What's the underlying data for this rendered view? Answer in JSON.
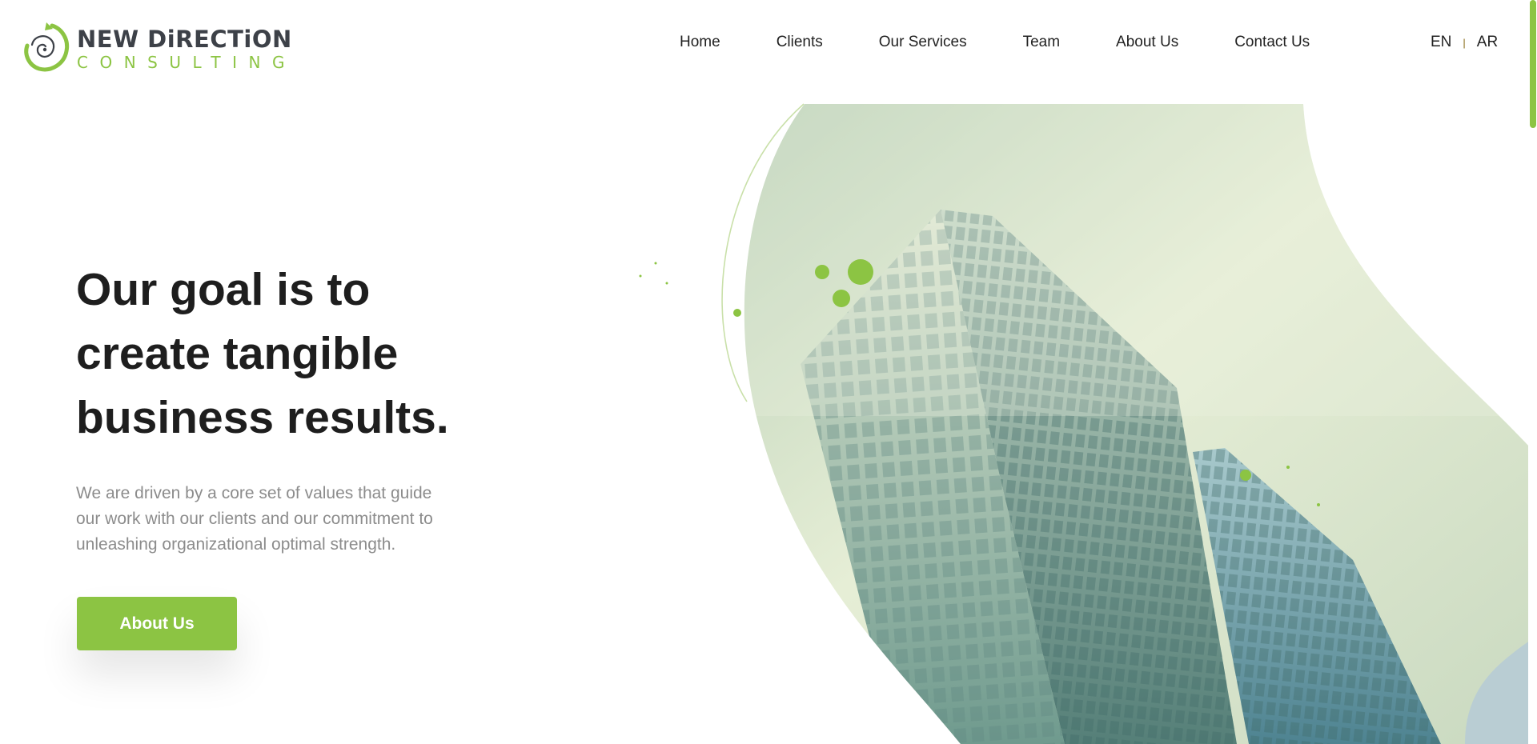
{
  "brand": {
    "name_line1": "NEW DiRECTiON",
    "name_line2": "CONSULTING",
    "logo_icon": "spiral-logo-icon",
    "accent_color": "#8cc443",
    "dark_color": "#3d4148"
  },
  "nav": {
    "items": [
      {
        "label": "Home"
      },
      {
        "label": "Clients"
      },
      {
        "label": "Our Services"
      },
      {
        "label": "Team"
      },
      {
        "label": "About Us"
      },
      {
        "label": "Contact Us"
      }
    ]
  },
  "language": {
    "en": "EN",
    "separator": "|",
    "ar": "AR"
  },
  "hero": {
    "title": "Our goal is to create tangible business results.",
    "description": "We are driven by a core set of values that guide our work with our clients and our commitment to unleashing organizational optimal strength.",
    "cta_label": "About Us",
    "image": "office-buildings-photo"
  }
}
